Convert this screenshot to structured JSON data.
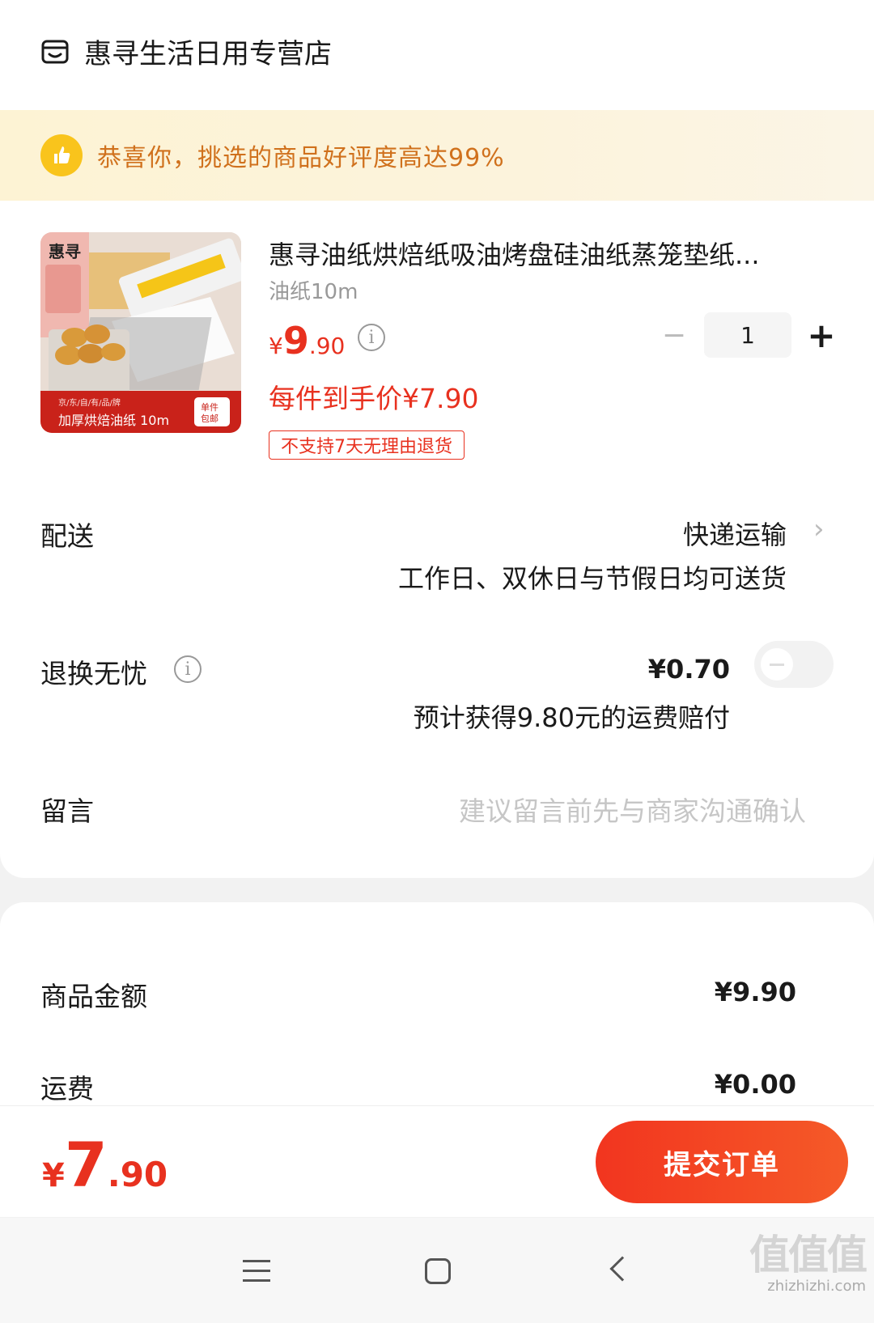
{
  "store": {
    "name": "惠寻生活日用专营店",
    "icon": "store-icon"
  },
  "banner": {
    "text": "恭喜你，挑选的商品好评度高达99%",
    "icon": "thumbs-up-icon"
  },
  "product": {
    "title": "惠寻油纸烘焙纸吸油烤盘硅油纸蒸笼垫纸...",
    "spec": "油纸10m",
    "price_symbol": "¥",
    "price_int": "9",
    "price_dec": ".90",
    "quantity": "1",
    "final_price": "每件到手价¥7.90",
    "return_tag": "不支持7天无理由退货",
    "image": {
      "brand": "惠寻",
      "caption_small": "京/东/自/有/品/牌",
      "caption": "加厚烘焙油纸 10m",
      "badge_line1": "单件",
      "badge_line2": "包邮"
    }
  },
  "delivery": {
    "label": "配送",
    "method": "快递运输",
    "note": "工作日、双休日与节假日均可送货"
  },
  "return_insurance": {
    "label": "退换无忧",
    "price": "¥0.70",
    "note": "预计获得9.80元的运费赔付",
    "enabled": false
  },
  "message": {
    "label": "留言",
    "placeholder": "建议留言前先与商家沟通确认"
  },
  "summary": {
    "goods_label": "商品金额",
    "goods_amount": "¥9.90",
    "shipping_label": "运费",
    "shipping_amount": "¥0.00"
  },
  "footer": {
    "total_symbol": "¥",
    "total_int": "7",
    "total_dec": ".90",
    "submit_label": "提交订单"
  },
  "watermark": {
    "big": "值值值",
    "small": "zhizhizhi.com"
  },
  "colors": {
    "accent": "#e8311f",
    "banner_text": "#d0711d",
    "banner_bg": "#fdf3d4"
  }
}
